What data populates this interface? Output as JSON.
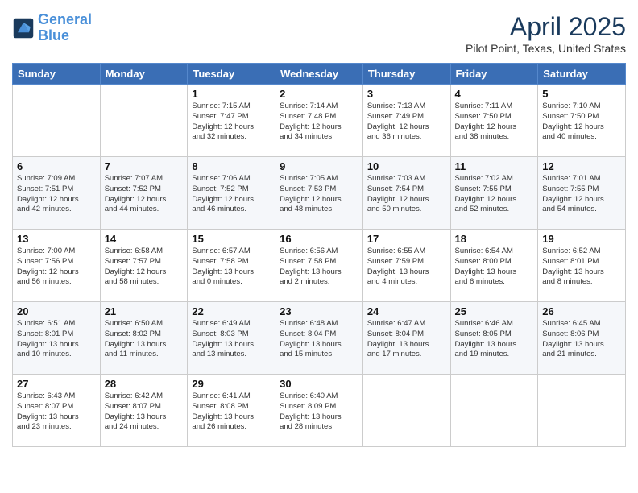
{
  "header": {
    "logo_line1": "General",
    "logo_line2": "Blue",
    "month": "April 2025",
    "location": "Pilot Point, Texas, United States"
  },
  "weekdays": [
    "Sunday",
    "Monday",
    "Tuesday",
    "Wednesday",
    "Thursday",
    "Friday",
    "Saturday"
  ],
  "weeks": [
    [
      {
        "day": "",
        "info": ""
      },
      {
        "day": "",
        "info": ""
      },
      {
        "day": "1",
        "info": "Sunrise: 7:15 AM\nSunset: 7:47 PM\nDaylight: 12 hours\nand 32 minutes."
      },
      {
        "day": "2",
        "info": "Sunrise: 7:14 AM\nSunset: 7:48 PM\nDaylight: 12 hours\nand 34 minutes."
      },
      {
        "day": "3",
        "info": "Sunrise: 7:13 AM\nSunset: 7:49 PM\nDaylight: 12 hours\nand 36 minutes."
      },
      {
        "day": "4",
        "info": "Sunrise: 7:11 AM\nSunset: 7:50 PM\nDaylight: 12 hours\nand 38 minutes."
      },
      {
        "day": "5",
        "info": "Sunrise: 7:10 AM\nSunset: 7:50 PM\nDaylight: 12 hours\nand 40 minutes."
      }
    ],
    [
      {
        "day": "6",
        "info": "Sunrise: 7:09 AM\nSunset: 7:51 PM\nDaylight: 12 hours\nand 42 minutes."
      },
      {
        "day": "7",
        "info": "Sunrise: 7:07 AM\nSunset: 7:52 PM\nDaylight: 12 hours\nand 44 minutes."
      },
      {
        "day": "8",
        "info": "Sunrise: 7:06 AM\nSunset: 7:52 PM\nDaylight: 12 hours\nand 46 minutes."
      },
      {
        "day": "9",
        "info": "Sunrise: 7:05 AM\nSunset: 7:53 PM\nDaylight: 12 hours\nand 48 minutes."
      },
      {
        "day": "10",
        "info": "Sunrise: 7:03 AM\nSunset: 7:54 PM\nDaylight: 12 hours\nand 50 minutes."
      },
      {
        "day": "11",
        "info": "Sunrise: 7:02 AM\nSunset: 7:55 PM\nDaylight: 12 hours\nand 52 minutes."
      },
      {
        "day": "12",
        "info": "Sunrise: 7:01 AM\nSunset: 7:55 PM\nDaylight: 12 hours\nand 54 minutes."
      }
    ],
    [
      {
        "day": "13",
        "info": "Sunrise: 7:00 AM\nSunset: 7:56 PM\nDaylight: 12 hours\nand 56 minutes."
      },
      {
        "day": "14",
        "info": "Sunrise: 6:58 AM\nSunset: 7:57 PM\nDaylight: 12 hours\nand 58 minutes."
      },
      {
        "day": "15",
        "info": "Sunrise: 6:57 AM\nSunset: 7:58 PM\nDaylight: 13 hours\nand 0 minutes."
      },
      {
        "day": "16",
        "info": "Sunrise: 6:56 AM\nSunset: 7:58 PM\nDaylight: 13 hours\nand 2 minutes."
      },
      {
        "day": "17",
        "info": "Sunrise: 6:55 AM\nSunset: 7:59 PM\nDaylight: 13 hours\nand 4 minutes."
      },
      {
        "day": "18",
        "info": "Sunrise: 6:54 AM\nSunset: 8:00 PM\nDaylight: 13 hours\nand 6 minutes."
      },
      {
        "day": "19",
        "info": "Sunrise: 6:52 AM\nSunset: 8:01 PM\nDaylight: 13 hours\nand 8 minutes."
      }
    ],
    [
      {
        "day": "20",
        "info": "Sunrise: 6:51 AM\nSunset: 8:01 PM\nDaylight: 13 hours\nand 10 minutes."
      },
      {
        "day": "21",
        "info": "Sunrise: 6:50 AM\nSunset: 8:02 PM\nDaylight: 13 hours\nand 11 minutes."
      },
      {
        "day": "22",
        "info": "Sunrise: 6:49 AM\nSunset: 8:03 PM\nDaylight: 13 hours\nand 13 minutes."
      },
      {
        "day": "23",
        "info": "Sunrise: 6:48 AM\nSunset: 8:04 PM\nDaylight: 13 hours\nand 15 minutes."
      },
      {
        "day": "24",
        "info": "Sunrise: 6:47 AM\nSunset: 8:04 PM\nDaylight: 13 hours\nand 17 minutes."
      },
      {
        "day": "25",
        "info": "Sunrise: 6:46 AM\nSunset: 8:05 PM\nDaylight: 13 hours\nand 19 minutes."
      },
      {
        "day": "26",
        "info": "Sunrise: 6:45 AM\nSunset: 8:06 PM\nDaylight: 13 hours\nand 21 minutes."
      }
    ],
    [
      {
        "day": "27",
        "info": "Sunrise: 6:43 AM\nSunset: 8:07 PM\nDaylight: 13 hours\nand 23 minutes."
      },
      {
        "day": "28",
        "info": "Sunrise: 6:42 AM\nSunset: 8:07 PM\nDaylight: 13 hours\nand 24 minutes."
      },
      {
        "day": "29",
        "info": "Sunrise: 6:41 AM\nSunset: 8:08 PM\nDaylight: 13 hours\nand 26 minutes."
      },
      {
        "day": "30",
        "info": "Sunrise: 6:40 AM\nSunset: 8:09 PM\nDaylight: 13 hours\nand 28 minutes."
      },
      {
        "day": "",
        "info": ""
      },
      {
        "day": "",
        "info": ""
      },
      {
        "day": "",
        "info": ""
      }
    ]
  ]
}
